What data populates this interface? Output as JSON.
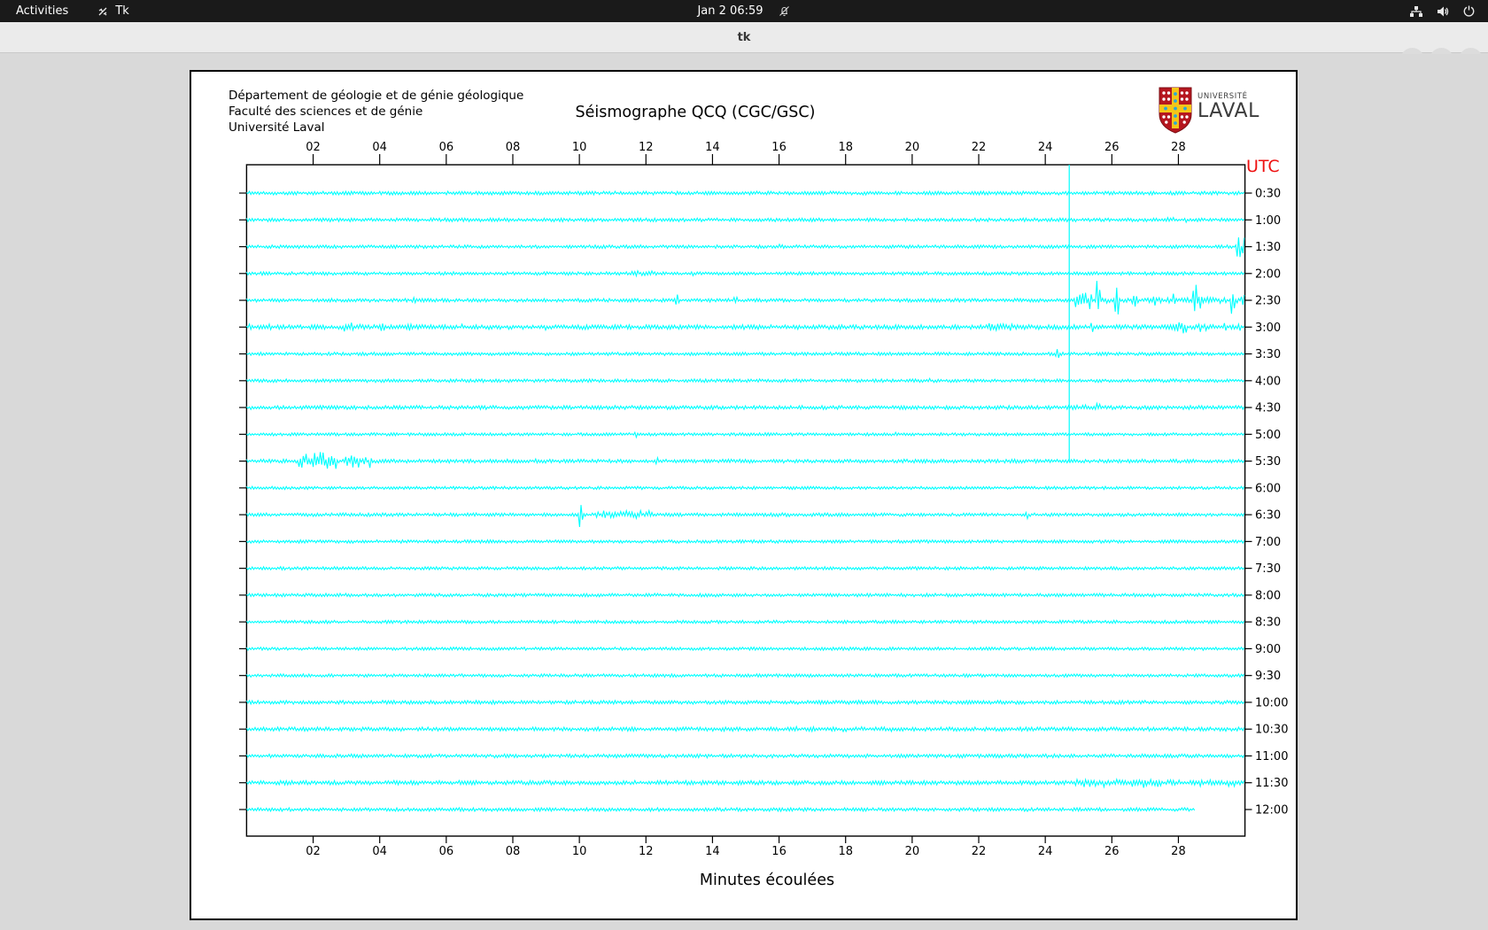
{
  "top_bar": {
    "activities": "Activities",
    "app_name": "Tk",
    "clock": "Jan 2  06:59",
    "icons": [
      "tk-icon",
      "notifications-disabled-icon",
      "network-wired-icon",
      "volume-icon",
      "power-icon"
    ]
  },
  "title_bar": {
    "title": "tk",
    "buttons": [
      "minimize",
      "maximize",
      "close"
    ]
  },
  "window": {
    "header_lines": [
      "Département de géologie et de génie géologique",
      "Faculté des sciences et de génie",
      "Université Laval"
    ],
    "logo": {
      "small": "UNIVERSITÉ",
      "large": "LAVAL"
    },
    "logo_colors": {
      "red": "#b5161f",
      "yellow": "#f5c518",
      "blue": "#2aa8d8"
    }
  },
  "chart_data": {
    "type": "line",
    "title": "Séismographe QCQ (CGC/GSC)",
    "xlabel": "Minutes écoulées",
    "right_axis_title": "UTC",
    "xlim": [
      0,
      30
    ],
    "x_ticks": [
      "02",
      "04",
      "06",
      "08",
      "10",
      "12",
      "14",
      "16",
      "18",
      "20",
      "22",
      "24",
      "26",
      "28"
    ],
    "trace_color": "#00ffff",
    "utc_color": "#ee1111",
    "vertical_line": {
      "minute": 24.72,
      "from_row": 0,
      "to_row": 10
    },
    "rows": [
      {
        "utc": "0:30",
        "base_amp": 2.0,
        "end_minute": 30,
        "events": []
      },
      {
        "utc": "1:00",
        "base_amp": 2.0,
        "end_minute": 30,
        "events": [
          {
            "burst": [
              27.6,
              28.4
            ],
            "amp": 4
          }
        ]
      },
      {
        "utc": "1:30",
        "base_amp": 1.9,
        "end_minute": 30,
        "events": [
          {
            "burst": [
              15.9,
              16.3
            ],
            "amp": 3.5
          },
          {
            "spike": 29.82,
            "amp": 13
          },
          {
            "spike": 29.95,
            "amp": 13
          }
        ]
      },
      {
        "utc": "2:00",
        "base_amp": 1.9,
        "end_minute": 30,
        "events": [
          {
            "burst": [
              11.5,
              12.2
            ],
            "amp": 4.5
          },
          {
            "spike": 13.4,
            "amp": 4
          }
        ]
      },
      {
        "utc": "2:30",
        "base_amp": 2.0,
        "end_minute": 30,
        "events": [
          {
            "spike": 5.05,
            "amp": 5
          },
          {
            "spike": 12.95,
            "amp": 9
          },
          {
            "spike": 14.7,
            "amp": 6
          },
          {
            "burst": [
              25.0,
              30.0
            ],
            "amp": 4
          },
          {
            "burst": [
              24.9,
              25.4
            ],
            "amp": 14
          },
          {
            "spike": 25.6,
            "amp": 24
          },
          {
            "spike": 26.15,
            "amp": 26
          },
          {
            "spike": 26.7,
            "amp": 14
          },
          {
            "spike": 27.3,
            "amp": 8
          },
          {
            "spike": 27.9,
            "amp": 10
          },
          {
            "spike": 28.5,
            "amp": 24
          },
          {
            "burst": [
              28.55,
              28.75
            ],
            "amp": 16
          },
          {
            "spike": 29.0,
            "amp": 9
          },
          {
            "spike": 29.65,
            "amp": 17
          },
          {
            "spike": 29.93,
            "amp": 12
          }
        ]
      },
      {
        "utc": "3:00",
        "base_amp": 2.6,
        "end_minute": 30,
        "events": [
          {
            "spike": 0.1,
            "amp": 7
          },
          {
            "spike": 0.7,
            "amp": 9
          },
          {
            "burst": [
              2.9,
              3.6
            ],
            "amp": 6
          },
          {
            "spike": 4.1,
            "amp": 6
          },
          {
            "spike": 4.9,
            "amp": 5
          },
          {
            "spike": 6.5,
            "amp": 5
          },
          {
            "spike": 9.0,
            "amp": 4
          },
          {
            "burst": [
              22.3,
              23.0
            ],
            "amp": 7
          },
          {
            "spike": 25.4,
            "amp": 8
          },
          {
            "burst": [
              27.8,
              28.25
            ],
            "amp": 11
          },
          {
            "burst": [
              28.45,
              28.9
            ],
            "amp": 7
          },
          {
            "spike": 29.4,
            "amp": 7
          },
          {
            "spike": 29.8,
            "amp": 5
          }
        ]
      },
      {
        "utc": "3:30",
        "base_amp": 1.9,
        "end_minute": 30,
        "events": [
          {
            "spike": 24.35,
            "amp": 8
          }
        ]
      },
      {
        "utc": "4:00",
        "base_amp": 1.9,
        "end_minute": 30,
        "events": [
          {
            "burst": [
              20.4,
              20.8
            ],
            "amp": 3.5
          }
        ]
      },
      {
        "utc": "4:30",
        "base_amp": 2.2,
        "end_minute": 30,
        "events": [
          {
            "burst": [
              24.9,
              25.3
            ],
            "amp": 4
          },
          {
            "spike": 25.6,
            "amp": 5
          }
        ]
      },
      {
        "utc": "5:00",
        "base_amp": 1.7,
        "end_minute": 30,
        "events": [
          {
            "spike": 11.7,
            "amp": 5
          },
          {
            "burst": [
              19.2,
              19.6
            ],
            "amp": 3
          }
        ]
      },
      {
        "utc": "5:30",
        "base_amp": 2.1,
        "end_minute": 30,
        "events": [
          {
            "burst": [
              1.55,
              2.7
            ],
            "amp": 12
          },
          {
            "burst": [
              2.95,
              3.6
            ],
            "amp": 10
          },
          {
            "spike": 3.72,
            "amp": 13
          },
          {
            "burst": [
              8.6,
              9.0
            ],
            "amp": 4
          },
          {
            "spike": 12.3,
            "amp": 5
          }
        ]
      },
      {
        "utc": "6:00",
        "base_amp": 1.7,
        "end_minute": 30,
        "events": []
      },
      {
        "utc": "6:30",
        "base_amp": 1.9,
        "end_minute": 30,
        "events": [
          {
            "spike": 10.05,
            "amp": 21
          },
          {
            "burst": [
              10.5,
              12.2
            ],
            "amp": 5.5
          },
          {
            "burst": [
              15.6,
              16.4
            ],
            "amp": 4
          },
          {
            "spike": 23.45,
            "amp": 7
          }
        ]
      },
      {
        "utc": "7:00",
        "base_amp": 1.8,
        "end_minute": 30,
        "events": []
      },
      {
        "utc": "7:30",
        "base_amp": 1.8,
        "end_minute": 30,
        "events": []
      },
      {
        "utc": "8:00",
        "base_amp": 1.9,
        "end_minute": 30,
        "events": []
      },
      {
        "utc": "8:30",
        "base_amp": 1.8,
        "end_minute": 30,
        "events": []
      },
      {
        "utc": "9:00",
        "base_amp": 1.8,
        "end_minute": 30,
        "events": []
      },
      {
        "utc": "9:30",
        "base_amp": 1.8,
        "end_minute": 30,
        "events": []
      },
      {
        "utc": "10:00",
        "base_amp": 2.1,
        "end_minute": 30,
        "events": []
      },
      {
        "utc": "10:30",
        "base_amp": 2.3,
        "end_minute": 30,
        "events": [
          {
            "burst": [
              16.3,
              19.5
            ],
            "amp": 3
          }
        ]
      },
      {
        "utc": "11:00",
        "base_amp": 2.1,
        "end_minute": 30,
        "events": []
      },
      {
        "utc": "11:30",
        "base_amp": 2.4,
        "end_minute": 30,
        "events": [
          {
            "burst": [
              24.7,
              30.0
            ],
            "amp": 5
          },
          {
            "burst": [
              26.5,
              27.5
            ],
            "amp": 6
          }
        ]
      },
      {
        "utc": "12:00",
        "base_amp": 2.0,
        "end_minute": 28.5,
        "events": []
      }
    ]
  }
}
